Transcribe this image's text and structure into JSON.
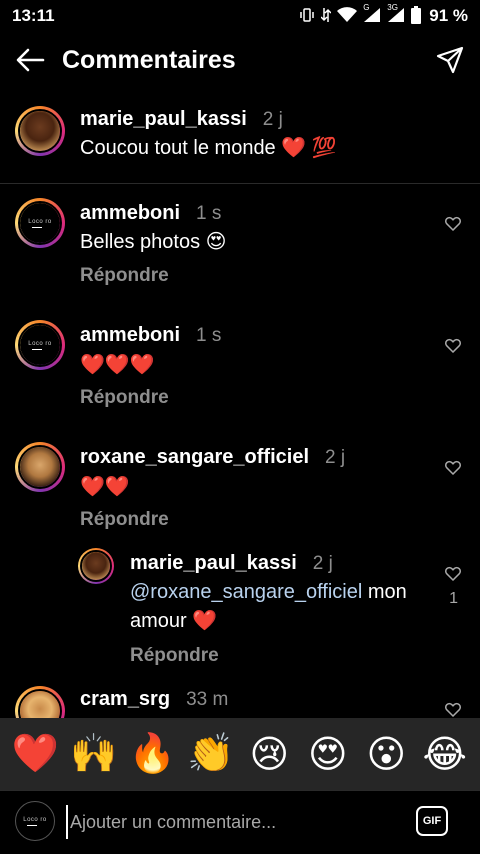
{
  "status_bar": {
    "time": "13:11",
    "network": "G",
    "network2": "3G",
    "battery": "91 %"
  },
  "header": {
    "title": "Commentaires",
    "back_icon": "arrow-left-icon",
    "share_icon": "send-icon"
  },
  "caption": {
    "username": "marie_paul_kassi",
    "time": "2 j",
    "text": "Coucou tout le monde ❤️ 💯"
  },
  "comments": [
    {
      "username": "ammeboni",
      "time": "1 s",
      "text": "Belles photos 😍",
      "reply": "Répondre"
    },
    {
      "username": "ammeboni",
      "time": "1 s",
      "text": "❤️❤️❤️",
      "reply": "Répondre"
    },
    {
      "username": "roxane_sangare_officiel",
      "time": "2 j",
      "text": "❤️❤️",
      "reply": "Répondre"
    },
    {
      "username": "marie_paul_kassi",
      "time": "2 j",
      "mention": "@roxane_sangare_officiel",
      "text_after": " mon",
      "text_line2": "amour ❤️",
      "reply": "Répondre",
      "likes": "1"
    },
    {
      "username": "cram_srg",
      "time": "33 m"
    }
  ],
  "logo_text": "Loco ro",
  "emoji_bar": [
    "❤️",
    "🙌",
    "🔥",
    "👏",
    "😢",
    "😍",
    "😮",
    "😂"
  ],
  "input": {
    "placeholder": "Ajouter un commentaire...",
    "gif_label": "GIF"
  },
  "colors": {
    "background": "#000000",
    "secondary_text": "#8e8e8e",
    "emoji_bar": "#262626",
    "mention": "#b9d2ee"
  }
}
